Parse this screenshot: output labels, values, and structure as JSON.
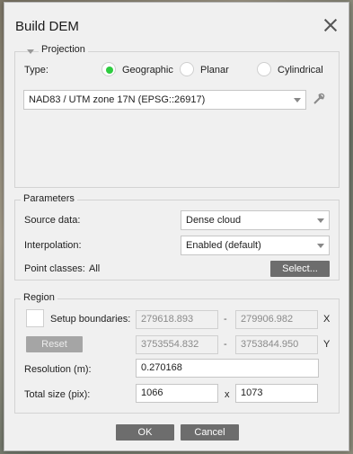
{
  "dialog": {
    "title": "Build DEM",
    "close_icon": "close-icon"
  },
  "projection": {
    "legend": "Projection",
    "type_label": "Type:",
    "types": [
      {
        "label": "Geographic",
        "checked": true
      },
      {
        "label": "Planar",
        "checked": false
      },
      {
        "label": "Cylindrical",
        "checked": false
      }
    ],
    "crs_value": "NAD83 / UTM zone 17N (EPSG::26917)",
    "crs_tool_icon": "crs-settings-icon"
  },
  "parameters": {
    "legend": "Parameters",
    "source_label": "Source data:",
    "source_value": "Dense cloud",
    "interp_label": "Interpolation:",
    "interp_value": "Enabled (default)",
    "classes_label": "Point classes:",
    "classes_value": "All",
    "select_button": "Select..."
  },
  "region": {
    "legend": "Region",
    "setup_label": "Setup boundaries:",
    "setup_checked": false,
    "x_min": "279618.893",
    "x_max": "279906.982",
    "x_axis": "X",
    "y_min": "3753554.832",
    "y_max": "3753844.950",
    "y_axis": "Y",
    "dash": "-",
    "reset_button": "Reset",
    "resolution_label": "Resolution (m):",
    "resolution_value": "0.270168",
    "size_label": "Total size (pix):",
    "size_w": "1066",
    "size_x": "x",
    "size_h": "1073"
  },
  "footer": {
    "ok": "OK",
    "cancel": "Cancel"
  },
  "colors": {
    "accent_radio": "#2ecc40",
    "button_bg": "#6d6d6d"
  }
}
